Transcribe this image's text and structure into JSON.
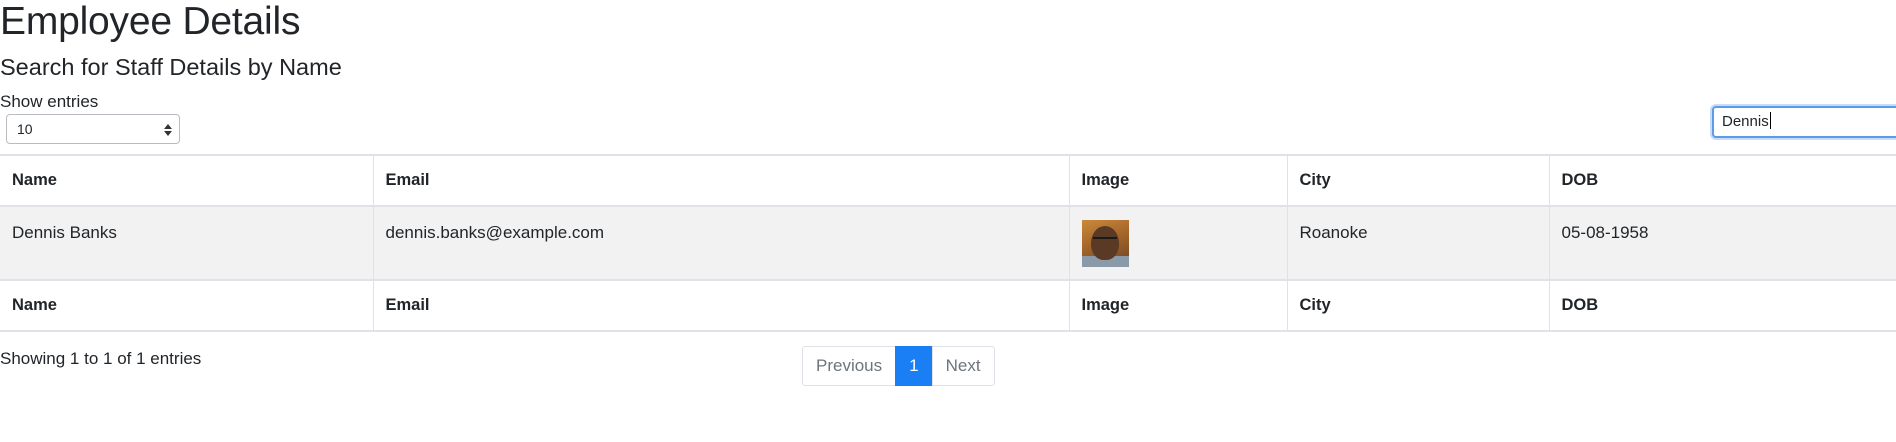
{
  "header": {
    "title": "Employee Details",
    "subtitle": "Search for Staff Details by Name"
  },
  "length_control": {
    "label": "Show entries",
    "selected": "10"
  },
  "search": {
    "value": "Dennis"
  },
  "table": {
    "columns": [
      "Name",
      "Email",
      "Image",
      "City",
      "DOB"
    ],
    "rows": [
      {
        "name": "Dennis Banks",
        "email": "dennis.banks@example.com",
        "image": "profile-photo-icon",
        "city": "Roanoke",
        "dob": "05-08-1958"
      }
    ]
  },
  "footer": {
    "info": "Showing 1 to 1 of 1 entries",
    "pagination": {
      "previous": "Previous",
      "current": "1",
      "next": "Next"
    }
  },
  "colors": {
    "accent": "#1a7ef5",
    "row_background": "#f2f2f2",
    "focus_ring": "#5b9bea"
  }
}
